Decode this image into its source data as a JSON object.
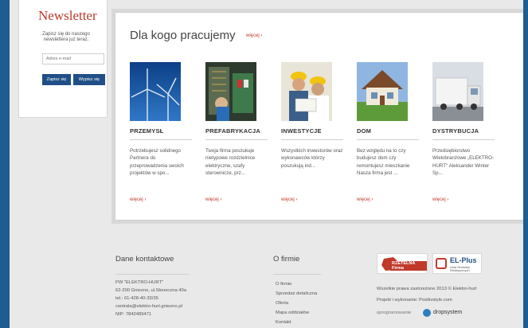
{
  "newsletter": {
    "title": "Newsletter",
    "description": "Zapisz się do naszego newslettera już teraz.",
    "email_placeholder": "Adres e-mail",
    "subscribe_label": "Zapisz się",
    "unsubscribe_label": "Wypisz się"
  },
  "panel": {
    "title": "Dla kogo pracujemy",
    "more_label": "więcej ›"
  },
  "cards": [
    {
      "title": "PRZEMYSŁ",
      "text": "Potrzebujesz solidnego Partnera do przeprowadzenia swoich projektów w spo...",
      "more": "więcej ›"
    },
    {
      "title": "PREFABRYKACJA",
      "text": "Twoja firma poszukuje nietypowe rozdzielnice elektryczne, szafy sterownicze, prz...",
      "more": "więcej ›"
    },
    {
      "title": "INWESTYCJE",
      "text": "Wszystkich inwestorów oraz wykonawców którzy poszukują ind...",
      "more": "więcej ›"
    },
    {
      "title": "DOM",
      "text": "Bez względu na to czy budujesz dom czy remontujesz mieszkanie Nasza firma jest ...",
      "more": "więcej ›"
    },
    {
      "title": "DYSTRYBUCJA",
      "text": "Przedsiębiorstwo Wielobranżowe „ELEKTRO-HURT\" Aleksander Winter Sp...",
      "more": "więcej ›"
    }
  ],
  "footer": {
    "contact": {
      "title": "Dane kontaktowe",
      "lines": [
        "PW \"ELEKTRO-HURT\"",
        "62-200 Gniezno, ul.Słoneczna 40a",
        "tel.: 61-428-40-33/35",
        "centrala@elektro-hurt.gniezno.pl",
        "NIP: 7842489471"
      ]
    },
    "about": {
      "title": "O firmie",
      "links": [
        "O firmie",
        "Sprzedaż detaliczna",
        "Oferta",
        "Mapa oddziałów",
        "Kontakt"
      ]
    },
    "badges": {
      "rzetelna_label": "RZETELNA Firma",
      "elplus_label": "EL-Plus",
      "elplus_sub": "Unia Hurtowni Elektrycznych"
    },
    "copyright": "Wszelkie prawa zastrzeżone 2013 © Elektro-hurt",
    "project": "Projekt i wykonanie: Positivstyle.com",
    "software_label": "oprogramowanie",
    "software_brand": "dropsystem"
  },
  "colors": {
    "accent_red": "#c0392b",
    "navy_button": "#1f4f86",
    "frame_blue": "#1f5c92"
  }
}
